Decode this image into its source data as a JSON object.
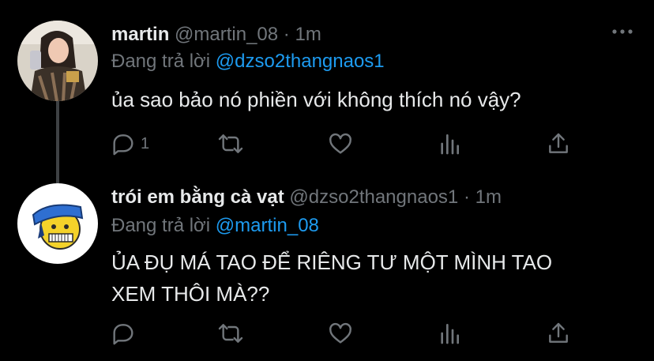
{
  "tweets": [
    {
      "name": "martin",
      "handle": "@martin_08",
      "separator": "·",
      "time": "1m",
      "reply_prefix": "Đang trả lời",
      "reply_to": "@dzso2thangnaos1",
      "text": "ủa sao bảo nó phiền với không thích nó vậy?",
      "reply_count": "1",
      "icons": [
        "reply-icon",
        "retweet-icon",
        "like-icon",
        "analytics-icon",
        "share-icon",
        "more-icon"
      ]
    },
    {
      "name": "trói em bằng cà vạt",
      "handle": "@dzso2thangnaos1",
      "separator": "·",
      "time": "1m",
      "reply_prefix": "Đang trả lời",
      "reply_to": "@martin_08",
      "text_line1": "ỦA ĐỤ MÁ TAO ĐỂ RIÊNG TƯ MỘT MÌNH TAO",
      "text_line2": "XEM THÔI MÀ??",
      "reply_count": "",
      "icons": [
        "reply-icon",
        "retweet-icon",
        "like-icon",
        "analytics-icon",
        "share-icon",
        "more-icon"
      ]
    }
  ],
  "colors": {
    "background": "#000000",
    "text": "#e7e9ea",
    "muted": "#71767b",
    "link": "#1d9bf0"
  }
}
